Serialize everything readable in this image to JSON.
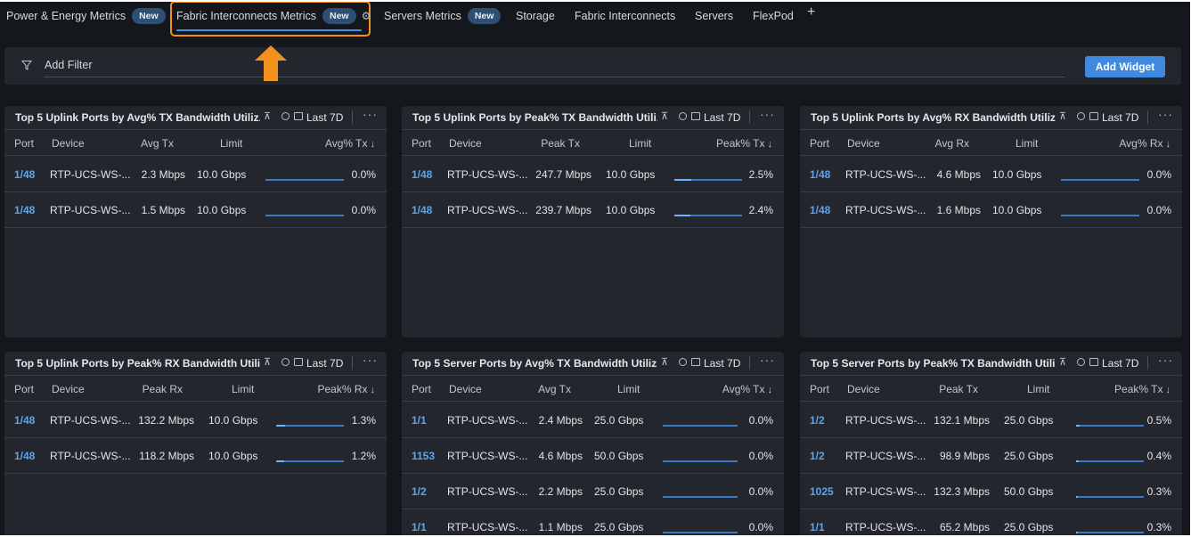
{
  "tabs": [
    {
      "label": "Power & Energy Metrics",
      "badge": "New"
    },
    {
      "label": "Fabric Interconnects Metrics",
      "badge": "New"
    },
    {
      "label": "Servers Metrics",
      "badge": "New"
    },
    {
      "label": "Storage"
    },
    {
      "label": "Fabric Interconnects"
    },
    {
      "label": "Servers"
    },
    {
      "label": "FlexPod"
    }
  ],
  "add_tab_label": "+",
  "gear_glyph": "⚙",
  "filter": {
    "placeholder": "Add Filter",
    "value": ""
  },
  "add_widget_label": "Add Widget",
  "colors": {
    "accent": "#3f8ae0",
    "highlight": "#f2911d",
    "link": "#5fa3ec",
    "background": "#14171c",
    "card": "#23272d"
  },
  "cards": [
    {
      "title": "Top 5 Uplink Ports by Avg% TX Bandwidth Utiliz...",
      "range": "Last 7D",
      "columns": [
        "Port",
        "Device",
        "Avg Tx",
        "Limit",
        "Avg% Tx"
      ],
      "rows": [
        {
          "port": "1/48",
          "device": "RTP-UCS-WS-...",
          "value": "2.3 Mbps",
          "limit": "10.0 Gbps",
          "pct": "0.0%",
          "fill": 0.0
        },
        {
          "port": "1/48",
          "device": "RTP-UCS-WS-...",
          "value": "1.5 Mbps",
          "limit": "10.0 Gbps",
          "pct": "0.0%",
          "fill": 0.0
        }
      ]
    },
    {
      "title": "Top 5 Uplink Ports by Peak% TX Bandwidth Utili...",
      "range": "Last 7D",
      "columns": [
        "Port",
        "Device",
        "Peak Tx",
        "Limit",
        "Peak% Tx"
      ],
      "rows": [
        {
          "port": "1/48",
          "device": "RTP-UCS-WS-...",
          "value": "247.7 Mbps",
          "limit": "10.0 Gbps",
          "pct": "2.5%",
          "fill": 0.025
        },
        {
          "port": "1/48",
          "device": "RTP-UCS-WS-...",
          "value": "239.7 Mbps",
          "limit": "10.0 Gbps",
          "pct": "2.4%",
          "fill": 0.024
        }
      ]
    },
    {
      "title": "Top 5 Uplink Ports by Avg% RX Bandwidth Utiliz...",
      "range": "Last 7D",
      "columns": [
        "Port",
        "Device",
        "Avg Rx",
        "Limit",
        "Avg% Rx"
      ],
      "rows": [
        {
          "port": "1/48",
          "device": "RTP-UCS-WS-...",
          "value": "4.6 Mbps",
          "limit": "10.0 Gbps",
          "pct": "0.0%",
          "fill": 0.0
        },
        {
          "port": "1/48",
          "device": "RTP-UCS-WS-...",
          "value": "1.6 Mbps",
          "limit": "10.0 Gbps",
          "pct": "0.0%",
          "fill": 0.0
        }
      ]
    },
    {
      "title": "Top 5 Uplink Ports by Peak% RX Bandwidth Utili...",
      "range": "Last 7D",
      "columns": [
        "Port",
        "Device",
        "Peak Rx",
        "Limit",
        "Peak% Rx"
      ],
      "rows": [
        {
          "port": "1/48",
          "device": "RTP-UCS-WS-...",
          "value": "132.2 Mbps",
          "limit": "10.0 Gbps",
          "pct": "1.3%",
          "fill": 0.013
        },
        {
          "port": "1/48",
          "device": "RTP-UCS-WS-...",
          "value": "118.2 Mbps",
          "limit": "10.0 Gbps",
          "pct": "1.2%",
          "fill": 0.012
        }
      ]
    },
    {
      "title": "Top 5 Server Ports by Avg% TX Bandwidth Utiliz...",
      "range": "Last 7D",
      "columns": [
        "Port",
        "Device",
        "Avg Tx",
        "Limit",
        "Avg% Tx"
      ],
      "rows": [
        {
          "port": "1/1",
          "device": "RTP-UCS-WS-...",
          "value": "2.4 Mbps",
          "limit": "25.0 Gbps",
          "pct": "0.0%",
          "fill": 0.0
        },
        {
          "port": "1153",
          "device": "RTP-UCS-WS-...",
          "value": "4.6 Mbps",
          "limit": "50.0 Gbps",
          "pct": "0.0%",
          "fill": 0.0
        },
        {
          "port": "1/2",
          "device": "RTP-UCS-WS-...",
          "value": "2.2 Mbps",
          "limit": "25.0 Gbps",
          "pct": "0.0%",
          "fill": 0.0
        },
        {
          "port": "1/1",
          "device": "RTP-UCS-WS-...",
          "value": "1.1 Mbps",
          "limit": "25.0 Gbps",
          "pct": "0.0%",
          "fill": 0.0
        }
      ]
    },
    {
      "title": "Top 5 Server Ports by Peak% TX Bandwidth Utili...",
      "range": "Last 7D",
      "columns": [
        "Port",
        "Device",
        "Peak Tx",
        "Limit",
        "Peak% Tx"
      ],
      "rows": [
        {
          "port": "1/2",
          "device": "RTP-UCS-WS-...",
          "value": "132.1 Mbps",
          "limit": "25.0 Gbps",
          "pct": "0.5%",
          "fill": 0.005
        },
        {
          "port": "1/2",
          "device": "RTP-UCS-WS-...",
          "value": "98.9 Mbps",
          "limit": "25.0 Gbps",
          "pct": "0.4%",
          "fill": 0.004
        },
        {
          "port": "1025",
          "device": "RTP-UCS-WS-...",
          "value": "132.3 Mbps",
          "limit": "50.0 Gbps",
          "pct": "0.3%",
          "fill": 0.003
        },
        {
          "port": "1/1",
          "device": "RTP-UCS-WS-...",
          "value": "65.2 Mbps",
          "limit": "25.0 Gbps",
          "pct": "0.3%",
          "fill": 0.003
        }
      ]
    }
  ]
}
